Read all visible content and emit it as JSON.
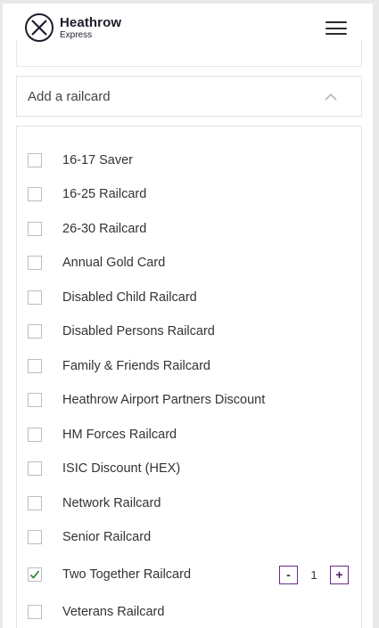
{
  "header": {
    "logo_name": "Heathrow",
    "logo_sub": "Express"
  },
  "railcard_dropdown": {
    "label": "Add a railcard",
    "expanded": true
  },
  "railcards": [
    {
      "label": "16-17 Saver",
      "checked": false
    },
    {
      "label": "16-25 Railcard",
      "checked": false
    },
    {
      "label": "26-30 Railcard",
      "checked": false
    },
    {
      "label": "Annual Gold Card",
      "checked": false
    },
    {
      "label": "Disabled Child Railcard",
      "checked": false
    },
    {
      "label": "Disabled Persons Railcard",
      "checked": false
    },
    {
      "label": "Family & Friends Railcard",
      "checked": false
    },
    {
      "label": "Heathrow Airport Partners Discount",
      "checked": false
    },
    {
      "label": "HM Forces Railcard",
      "checked": false
    },
    {
      "label": "ISIC Discount (HEX)",
      "checked": false
    },
    {
      "label": "Network Railcard",
      "checked": false
    },
    {
      "label": "Senior Railcard",
      "checked": false
    },
    {
      "label": "Two Together Railcard",
      "checked": true,
      "quantity": "1"
    },
    {
      "label": "Veterans Railcard",
      "checked": false
    }
  ],
  "stepper": {
    "minus_label": "-",
    "plus_label": "+"
  },
  "colors": {
    "accent": "#6a2a88",
    "check": "#2e8b3a",
    "border": "#e3e3e6"
  }
}
